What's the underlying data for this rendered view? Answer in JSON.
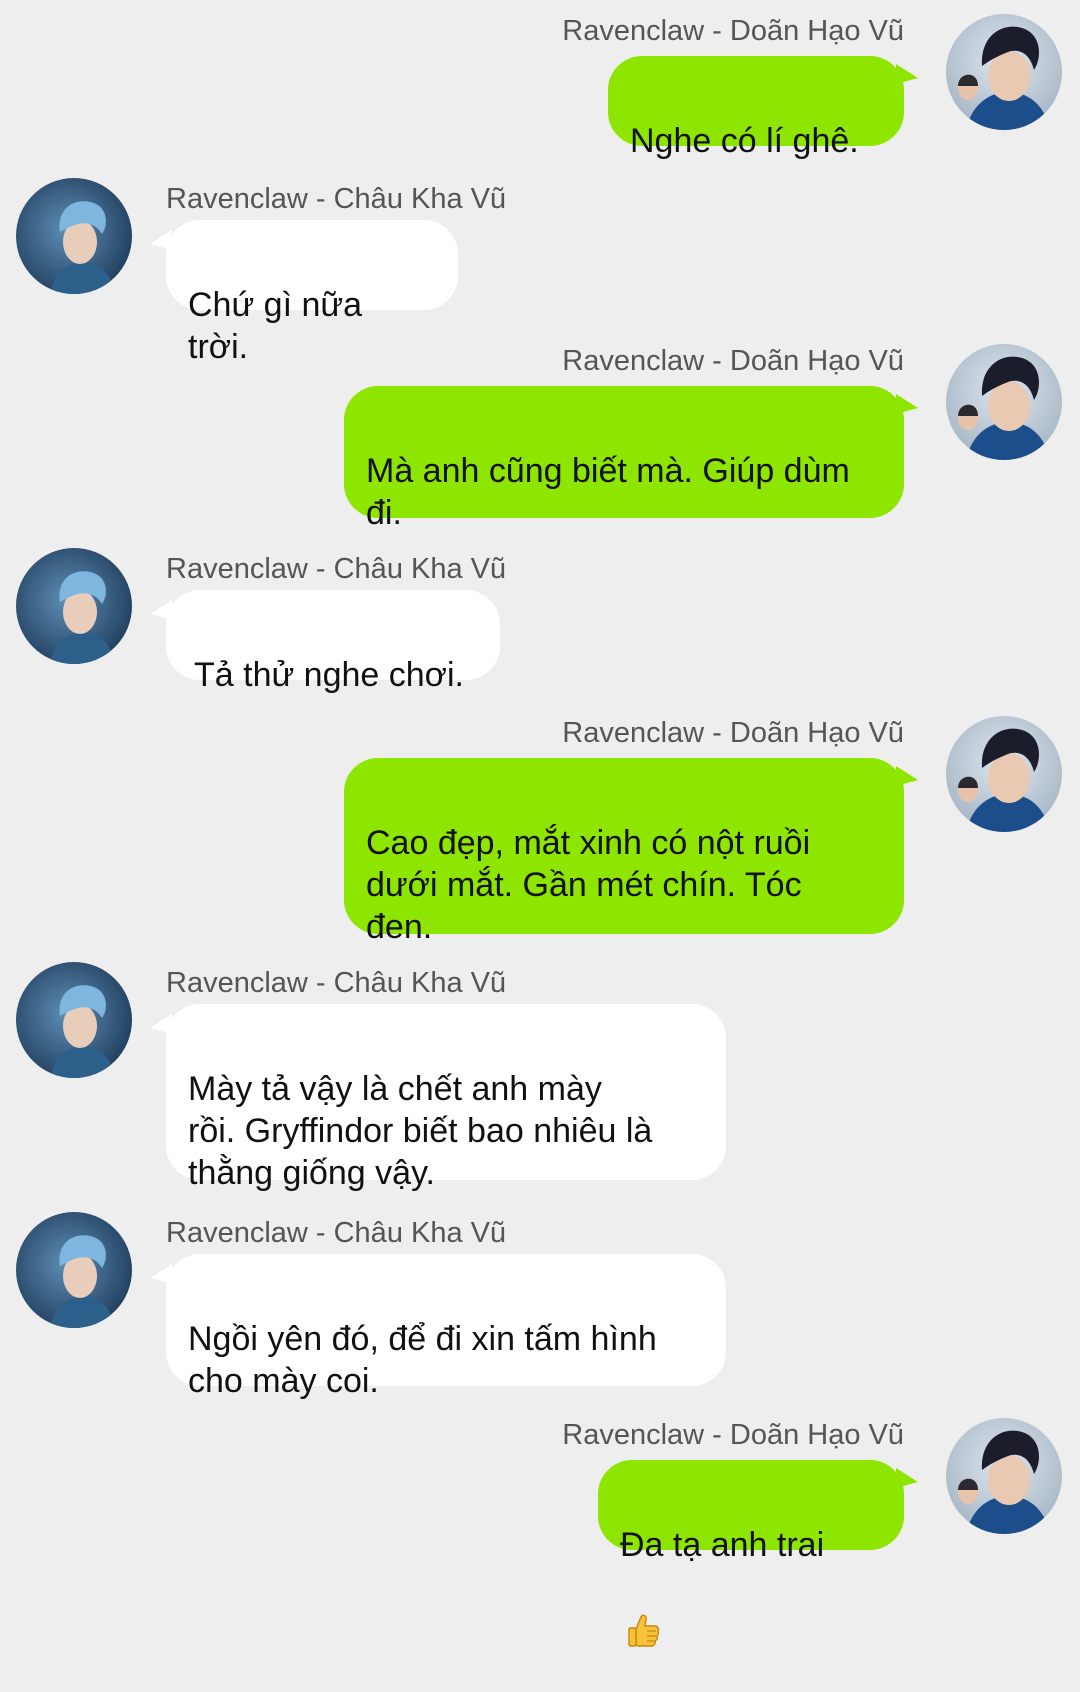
{
  "thread": {
    "messages": [
      {
        "side": "right",
        "sender": "Ravenclaw - Doãn Hạo Vũ",
        "text": "Nghe có lí ghê."
      },
      {
        "side": "left",
        "sender": "Ravenclaw - Châu Kha Vũ",
        "text": "Chứ gì nữa trời."
      },
      {
        "side": "right",
        "sender": "Ravenclaw - Doãn Hạo Vũ",
        "text": "Mà anh cũng biết mà. Giúp dùm\nđi."
      },
      {
        "side": "left",
        "sender": "Ravenclaw - Châu Kha Vũ",
        "text": "Tả thử nghe chơi."
      },
      {
        "side": "right",
        "sender": "Ravenclaw - Doãn Hạo Vũ",
        "text": "Cao đẹp, mắt xinh có nột ruồi\ndưới mắt. Gần mét chín. Tóc\nđen."
      },
      {
        "side": "left",
        "sender": "Ravenclaw - Châu Kha Vũ",
        "text": "Mày tả vậy là chết anh mày\nrồi. Gryffindor biết bao nhiêu là\nthằng giống vậy."
      },
      {
        "side": "left",
        "sender": "Ravenclaw - Châu Kha Vũ",
        "text": "Ngồi yên đó, để đi xin tấm hình\ncho mày coi."
      },
      {
        "side": "right",
        "sender": "Ravenclaw - Doãn Hạo Vũ",
        "text": "Đa tạ anh trai",
        "emoji": "thumbs-up-icon"
      }
    ]
  },
  "colors": {
    "background": "#eeeeee",
    "outgoing_bubble": "#8ee500",
    "incoming_bubble": "#ffffff",
    "sender_name": "#555555"
  }
}
